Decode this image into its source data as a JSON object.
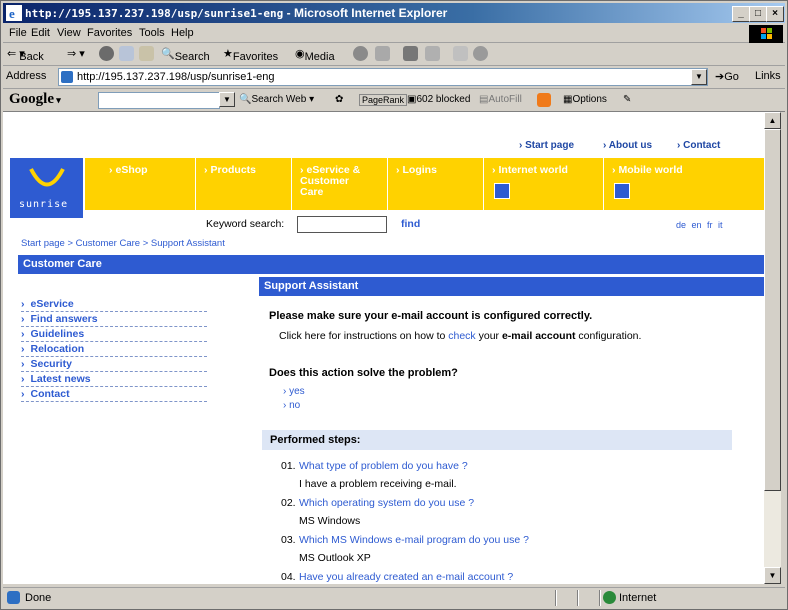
{
  "window": {
    "title_url": "http://195.137.237.198/usp/sunrise1-eng",
    "title_suffix": " - Microsoft Internet Explorer"
  },
  "menu": [
    "File",
    "Edit",
    "View",
    "Favorites",
    "Tools",
    "Help"
  ],
  "toolbar": {
    "back": "Back",
    "search": "Search",
    "favorites": "Favorites",
    "media": "Media"
  },
  "address": {
    "label": "Address",
    "value": "http://195.137.237.198/usp/sunrise1-eng",
    "go": "Go",
    "links": "Links"
  },
  "googlebar": {
    "logo": "Google",
    "search_web": "Search Web",
    "pagerank": "PageRank",
    "blocked": "602 blocked",
    "autofill": "AutoFill",
    "options": "Options"
  },
  "page": {
    "top_links": [
      "Start page",
      "About us",
      "Contact"
    ],
    "logo_text": "sunrise",
    "nav": [
      {
        "label": "eShop"
      },
      {
        "label": "Products"
      },
      {
        "label": "eService & Customer Care"
      },
      {
        "label": "Logins"
      },
      {
        "label": "Internet world"
      },
      {
        "label": "Mobile world"
      }
    ],
    "keyword_label": "Keyword search:",
    "find": "find",
    "languages": "de en fr it",
    "breadcrumb": "Start page > Customer Care > Support Assistant",
    "section_title": "Customer Care",
    "sidebar": [
      "eService",
      "Find answers",
      "Guidelines",
      "Relocation",
      "Security",
      "Latest news",
      "Contact"
    ],
    "support_title": "Support Assistant",
    "heading": "Please make sure your e-mail account is configured correctly.",
    "instr_prefix": "Click here for instructions on how to ",
    "instr_link": "check",
    "instr_mid": " your ",
    "instr_bold": "e-mail account",
    "instr_suffix": " configuration.",
    "question": "Does this action solve the problem?",
    "options": [
      "yes",
      "no"
    ],
    "performed_title": "Performed steps:",
    "steps": [
      {
        "num": "01.",
        "q": "What type of problem do you have ?",
        "a": "I have a problem receiving e-mail."
      },
      {
        "num": "02.",
        "q": "Which operating system do you use ?",
        "a": "MS Windows"
      },
      {
        "num": "03.",
        "q": "Which MS Windows e-mail program do you use ?",
        "a": "MS Outlook XP"
      },
      {
        "num": "04.",
        "q": "Have you already created an e-mail account ?",
        "a": ""
      }
    ]
  },
  "status": {
    "text": "Done",
    "zone": "Internet"
  },
  "colors": {
    "brand_blue": "#2e5bd1",
    "nav_yellow": "#ffd200"
  }
}
